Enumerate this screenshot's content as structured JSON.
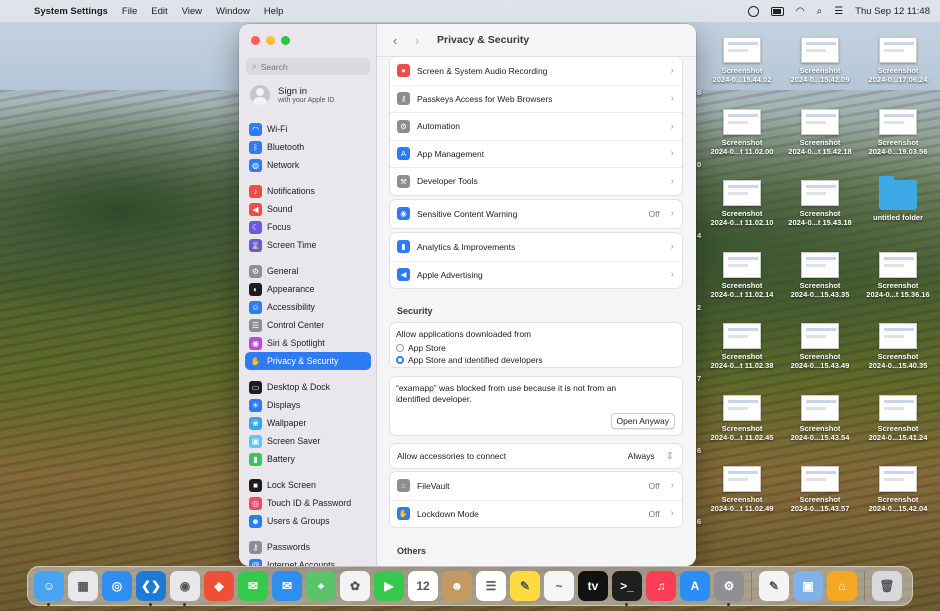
{
  "menubar": {
    "app_name": "System Settings",
    "menus": [
      "File",
      "Edit",
      "View",
      "Window",
      "Help"
    ],
    "clock": "Thu Sep 12  11:48"
  },
  "window": {
    "title": "Privacy & Security",
    "search_placeholder": "Search",
    "account": {
      "name": "Sign in",
      "sub": "with your Apple ID"
    },
    "sidebar": [
      {
        "label": "Wi-Fi",
        "icon": "wifi-icon",
        "color": "#2d7cf6"
      },
      {
        "label": "Bluetooth",
        "icon": "bluetooth-icon",
        "color": "#2d7cf6"
      },
      {
        "label": "Network",
        "icon": "globe-icon",
        "color": "#2d7cf6"
      },
      {
        "label": "Notifications",
        "icon": "bell-icon",
        "color": "#ee4b4b"
      },
      {
        "label": "Sound",
        "icon": "speaker-icon",
        "color": "#ee4b4b"
      },
      {
        "label": "Focus",
        "icon": "moon-icon",
        "color": "#6a5ae0"
      },
      {
        "label": "Screen Time",
        "icon": "hourglass-icon",
        "color": "#6a5ae0"
      },
      {
        "label": "General",
        "icon": "gear-icon",
        "color": "#8e8d92"
      },
      {
        "label": "Appearance",
        "icon": "appearance-icon",
        "color": "#1d1d1f"
      },
      {
        "label": "Accessibility",
        "icon": "accessibility-icon",
        "color": "#2d7cf6"
      },
      {
        "label": "Control Center",
        "icon": "control-center-icon",
        "color": "#8e8d92"
      },
      {
        "label": "Siri & Spotlight",
        "icon": "siri-icon",
        "color": "#b94ad8"
      },
      {
        "label": "Privacy & Security",
        "icon": "hand-icon",
        "color": "#2d7cf6"
      },
      {
        "label": "Desktop & Dock",
        "icon": "dock-icon",
        "color": "#1d1d1f"
      },
      {
        "label": "Displays",
        "icon": "display-icon",
        "color": "#2d7cf6"
      },
      {
        "label": "Wallpaper",
        "icon": "wallpaper-icon",
        "color": "#37a7e8"
      },
      {
        "label": "Screen Saver",
        "icon": "screensaver-icon",
        "color": "#5ac8fa"
      },
      {
        "label": "Battery",
        "icon": "battery-icon",
        "color": "#34c759"
      },
      {
        "label": "Lock Screen",
        "icon": "lock-icon",
        "color": "#1d1d1f"
      },
      {
        "label": "Touch ID & Password",
        "icon": "fingerprint-icon",
        "color": "#ee4b6b"
      },
      {
        "label": "Users & Groups",
        "icon": "users-icon",
        "color": "#2d7cf6"
      },
      {
        "label": "Passwords",
        "icon": "key-icon",
        "color": "#8e8d92"
      },
      {
        "label": "Internet Accounts",
        "icon": "at-icon",
        "color": "#2d7cf6"
      }
    ],
    "selected_sidebar": "Privacy & Security",
    "groups": {
      "g1": [
        {
          "label": "Screen & System Audio Recording",
          "icon": "record-icon",
          "color": "#ee4b4b"
        },
        {
          "label": "Passkeys Access for Web Browsers",
          "icon": "passkey-icon",
          "color": "#8e8d92"
        },
        {
          "label": "Automation",
          "icon": "automation-icon",
          "color": "#8e8d92"
        },
        {
          "label": "App Management",
          "icon": "app-store-icon",
          "color": "#2d7cf6"
        },
        {
          "label": "Developer Tools",
          "icon": "hammer-icon",
          "color": "#8e8d92"
        }
      ],
      "g2": [
        {
          "label": "Sensitive Content Warning",
          "icon": "eye-icon",
          "color": "#2d7cf6",
          "value": "Off"
        }
      ],
      "g3": [
        {
          "label": "Analytics & Improvements",
          "icon": "chart-icon",
          "color": "#2d7cf6"
        },
        {
          "label": "Apple Advertising",
          "icon": "megaphone-icon",
          "color": "#2d7cf6"
        }
      ]
    },
    "security": {
      "heading": "Security",
      "allow_label": "Allow applications downloaded from",
      "options": [
        "App Store",
        "App Store and identified developers"
      ],
      "selected_option": "App Store and identified developers",
      "blocked_message": "“examapp” was blocked from use because it is not from an identified developer.",
      "open_anyway": "Open Anyway",
      "accessories_label": "Allow accessories to connect",
      "accessories_value": "Always",
      "filevault_label": "FileVault",
      "filevault_value": "Off",
      "lockdown_label": "Lockdown Mode",
      "lockdown_value": "Off"
    },
    "others_heading": "Others"
  },
  "desktop": {
    "icons": [
      {
        "name": "Screenshot",
        "sub": "2024-0...15.44.02"
      },
      {
        "name": "Screenshot",
        "sub": "2024-0...15.42.09"
      },
      {
        "name": "Screenshot",
        "sub": "2024-0...17.06.24"
      },
      {
        "name": "Screenshot",
        "sub": "2024-0...t 11.02.00"
      },
      {
        "name": "Screenshot",
        "sub": "2024-0...t 15.42.18"
      },
      {
        "name": "Screenshot",
        "sub": "2024-0...19.03.56"
      },
      {
        "name": "Screenshot",
        "sub": "2024-0...t 11.02.10"
      },
      {
        "name": "Screenshot",
        "sub": "2024-0...t 15.43.18"
      },
      {
        "name": "untitled folder",
        "sub": ""
      },
      {
        "name": "Screenshot",
        "sub": "2024-0...t 11.02.14"
      },
      {
        "name": "Screenshot",
        "sub": "2024-0...15.43.35"
      },
      {
        "name": "Screenshot",
        "sub": "2024-0...t 15.36.16"
      },
      {
        "name": "Screenshot",
        "sub": "2024-0...t 11.02.38"
      },
      {
        "name": "Screenshot",
        "sub": "2024-0...15.43.49"
      },
      {
        "name": "Screenshot",
        "sub": "2024-0...15.40.35"
      },
      {
        "name": "Screenshot",
        "sub": "2024-0...t 11.02.45"
      },
      {
        "name": "Screenshot",
        "sub": "2024-0...15.43.54"
      },
      {
        "name": "Screenshot",
        "sub": "2024-0...15.41.24"
      },
      {
        "name": "Screenshot",
        "sub": "2024-0...t 11.02.49"
      },
      {
        "name": "Screenshot",
        "sub": "2024-0...15.43.57"
      },
      {
        "name": "Screenshot",
        "sub": "2024-0...15.42.04"
      }
    ],
    "peek_labels": [
      "9",
      "0",
      "4",
      "2",
      "7",
      "6",
      "6"
    ]
  },
  "dock": {
    "apps": [
      {
        "name": "finder-icon",
        "color": "#4aa3f0",
        "glyph": "☺",
        "running": true
      },
      {
        "name": "launchpad-icon",
        "color": "#e8e8ea",
        "glyph": "▦",
        "running": false
      },
      {
        "name": "safari-icon",
        "color": "#2f8ff0",
        "glyph": "◎",
        "running": false
      },
      {
        "name": "vscode-icon",
        "color": "#1f7ad6",
        "glyph": "❮❯",
        "running": true
      },
      {
        "name": "chrome-icon",
        "color": "#e8e8ea",
        "glyph": "◉",
        "running": true
      },
      {
        "name": "git-icon",
        "color": "#f04f37",
        "glyph": "◆",
        "running": false
      },
      {
        "name": "messages-icon",
        "color": "#36c94c",
        "glyph": "✉",
        "running": false
      },
      {
        "name": "mail-icon",
        "color": "#2f8ff0",
        "glyph": "✉",
        "running": false
      },
      {
        "name": "maps-icon",
        "color": "#5cc36a",
        "glyph": "⌖",
        "running": false
      },
      {
        "name": "photos-icon",
        "color": "#f3f3f3",
        "glyph": "✿",
        "running": false
      },
      {
        "name": "facetime-icon",
        "color": "#36c94c",
        "glyph": "▶",
        "running": false
      },
      {
        "name": "calendar-icon",
        "color": "#ffffff",
        "glyph": "12",
        "running": false
      },
      {
        "name": "contacts-icon",
        "color": "#c49a62",
        "glyph": "☻",
        "running": false
      },
      {
        "name": "reminders-icon",
        "color": "#ffffff",
        "glyph": "☰",
        "running": false
      },
      {
        "name": "notes-icon",
        "color": "#ffd940",
        "glyph": "✎",
        "running": false
      },
      {
        "name": "freeform-icon",
        "color": "#f5f5f5",
        "glyph": "~",
        "running": false
      },
      {
        "name": "appletv-icon",
        "color": "#111111",
        "glyph": "tv",
        "running": false
      },
      {
        "name": "terminal-icon",
        "color": "#1f1f1f",
        "glyph": ">_",
        "running": true
      },
      {
        "name": "music-icon",
        "color": "#fa3c55",
        "glyph": "♫",
        "running": false
      },
      {
        "name": "appstore-icon",
        "color": "#2a8ef5",
        "glyph": "A",
        "running": false
      },
      {
        "name": "system-settings-icon",
        "color": "#8e8e93",
        "glyph": "⚙",
        "running": true
      },
      {
        "name": "textedit-icon",
        "color": "#f4f4f4",
        "glyph": "✎",
        "running": false
      },
      {
        "name": "preview-icon",
        "color": "#7fb3e8",
        "glyph": "▣",
        "running": false
      },
      {
        "name": "home-icon",
        "color": "#f5a623",
        "glyph": "⌂",
        "running": false
      },
      {
        "name": "trash-icon",
        "color": "#d9d9dd",
        "glyph": "🗑",
        "running": false
      }
    ]
  }
}
